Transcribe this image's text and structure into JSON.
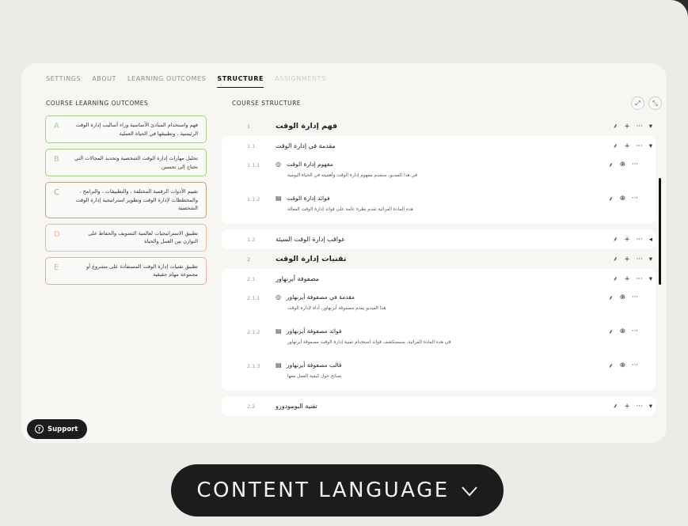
{
  "tabs": [
    "SETTINGS",
    "ABOUT",
    "LEARNING OUTCOMES",
    "STRUCTURE",
    "ASSIGNMENTS"
  ],
  "active_tab": "STRUCTURE",
  "left_header": "COURSE LEARNING OUTCOMES",
  "right_header": "COURSE STRUCTURE",
  "outcomes": [
    {
      "letter": "A",
      "text": "فهم واستخدام المبادئ الأساسية وراء أساليب إدارة الوقت الرئيسية ، وتطبيقها في الحياة العملية",
      "color": "#a8cf8a"
    },
    {
      "letter": "B",
      "text": "تحليل مهارات إدارة الوقت الشخصية وتحديد المجالات التي تحتاج إلى تحسين",
      "color": "#9ccf7e"
    },
    {
      "letter": "C",
      "text": "تقييم الأدوات الرقمية المختلفة ، والتطبيقات ، والبرامج ، والمخططات لإدارة الوقت وتطوير استراتيجية إدارة الوقت الشخصية",
      "color": "#c9a07a"
    },
    {
      "letter": "D",
      "text": "تطبيق الاستراتيجيات لعالمية التسويف والحفاظ على التوازن بين العمل والحياة",
      "color": "#f0b896"
    },
    {
      "letter": "E",
      "text": "تطبيق تقنيات إدارة الوقت المستفادة على مشروع أو مجموعة مهام حقيقية",
      "color": "#eda9a9"
    }
  ],
  "structure": {
    "s1": {
      "num": "1",
      "title": "فهم إدارة الوقت"
    },
    "s11": {
      "num": "1.1",
      "title": "مقدمة في إدارة الوقت"
    },
    "i111": {
      "num": "1.1.1",
      "title": "مفهوم إدارة الوقت",
      "desc": "في هذا الفيديو، سنقدم مفهوم إدارة الوقت وأهميته في الحياة اليومية",
      "icon": "play-icon"
    },
    "i112": {
      "num": "1.1.2",
      "title": "فوائد إدارة الوقت",
      "desc": "هذه المادة القرائية تقدم نظرة عامة على فوائد إدارة الوقت الفعالة",
      "icon": "reading-icon"
    },
    "s12": {
      "num": "1.2",
      "title": "عواقب إدارة الوقت السيئة"
    },
    "s2": {
      "num": "2",
      "title": "تقنيات إدارة الوقت"
    },
    "s21": {
      "num": "2.1",
      "title": "مصفوفة أيزنهاور"
    },
    "i211": {
      "num": "2.1.1",
      "title": "مقدمة في مصفوفة أيزنهاور",
      "desc": "هذا الفيديو يقدم مصفوفة أيزنهاور، أداة لإدارة الوقت",
      "icon": "play-icon"
    },
    "i212": {
      "num": "2.1.2",
      "title": "فوائد مصفوفة أيزنهاور",
      "desc": "في هذه المادة القرائية، سنستكشف فوائد استخدام تقنية إدارة الوقت مصفوفة أيزنهاور",
      "icon": "reading-icon"
    },
    "i213": {
      "num": "2.1.3",
      "title": "قالب مصفوفة أيزنهاور",
      "desc": "نصائح حول كيفية العمل معها",
      "icon": "reading-icon"
    },
    "s22": {
      "num": "2.2",
      "title": "تقنية البومودورو"
    }
  },
  "support_label": "Support",
  "language_label": "CONTENT LANGUAGE",
  "colors": {
    "accent": "#111111",
    "background": "#ecebe7",
    "card": "#f7f6f3"
  }
}
